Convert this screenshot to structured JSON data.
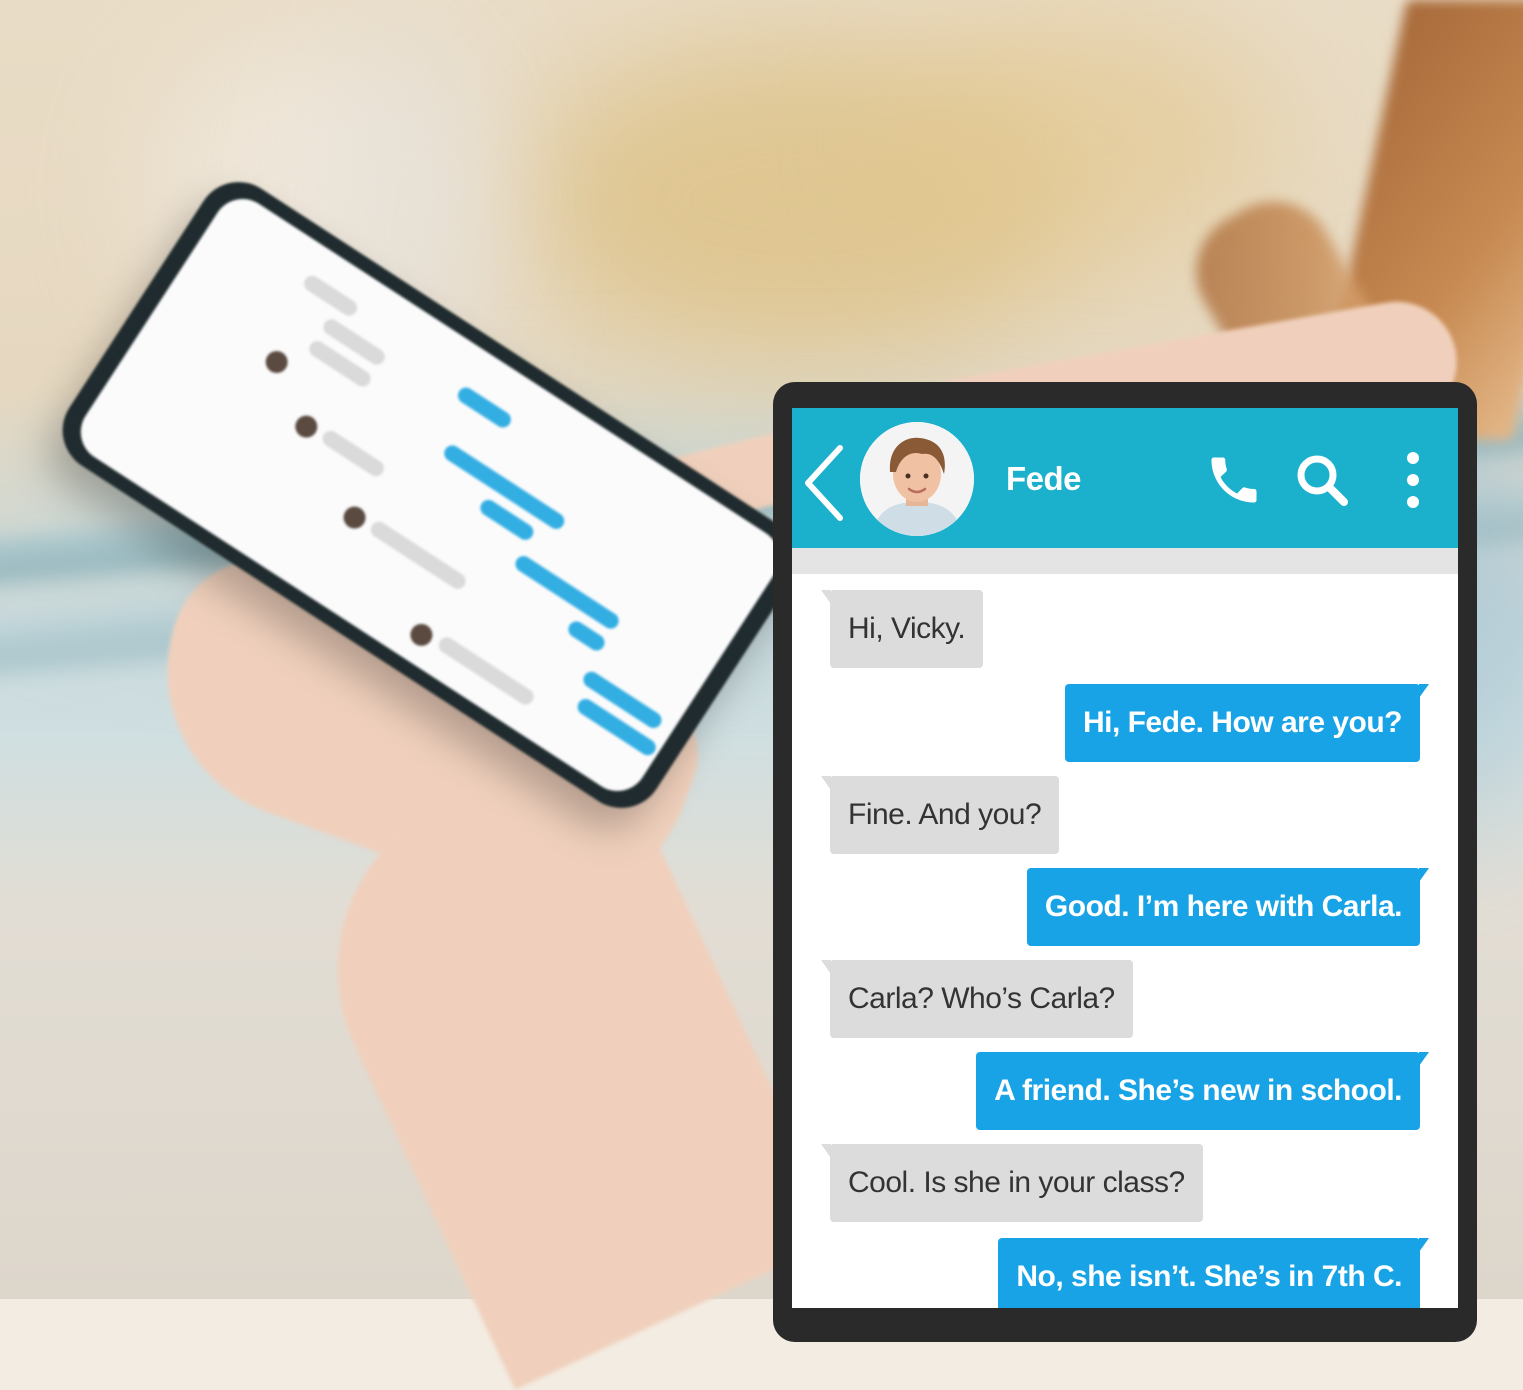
{
  "chat": {
    "contact_name": "Fede",
    "messages": [
      {
        "direction": "incoming",
        "text": "Hi, Vicky."
      },
      {
        "direction": "outgoing",
        "text": "Hi, Fede. How are you?"
      },
      {
        "direction": "incoming",
        "text": "Fine. And you?"
      },
      {
        "direction": "outgoing",
        "text": "Good. I’m here with Carla."
      },
      {
        "direction": "incoming",
        "text": "Carla? Who’s Carla?"
      },
      {
        "direction": "outgoing",
        "text": "A friend. She’s new in school."
      },
      {
        "direction": "incoming",
        "text": "Cool. Is she in your class?"
      },
      {
        "direction": "outgoing",
        "text": "No, she isn’t. She’s in 7th C."
      }
    ]
  },
  "icons": {
    "back": "chevron-left-icon",
    "call": "phone-icon",
    "search": "search-icon",
    "more": "more-vertical-icon"
  },
  "colors": {
    "header": "#1bb0cc",
    "outgoing_bubble": "#17a3e5",
    "incoming_bubble": "#dcdcdc"
  }
}
